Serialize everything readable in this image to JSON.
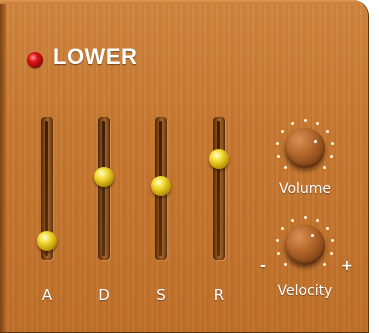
{
  "section": {
    "title": "LOWER",
    "power_led_color": "#e01515",
    "accent_color": "#c6772f"
  },
  "envelope": {
    "sliders": [
      {
        "key": "attack",
        "label": "A",
        "level": 0.06
      },
      {
        "key": "decay",
        "label": "D",
        "level": 0.6
      },
      {
        "key": "sustain",
        "label": "S",
        "level": 0.52
      },
      {
        "key": "release",
        "label": "R",
        "level": 0.75
      }
    ]
  },
  "knobs": [
    {
      "key": "volume",
      "label": "Volume",
      "level": 0.72,
      "signs": false
    },
    {
      "key": "velocity",
      "label": "Velocity",
      "level": 0.65,
      "signs": true,
      "minus": "-",
      "plus": "+"
    }
  ]
}
